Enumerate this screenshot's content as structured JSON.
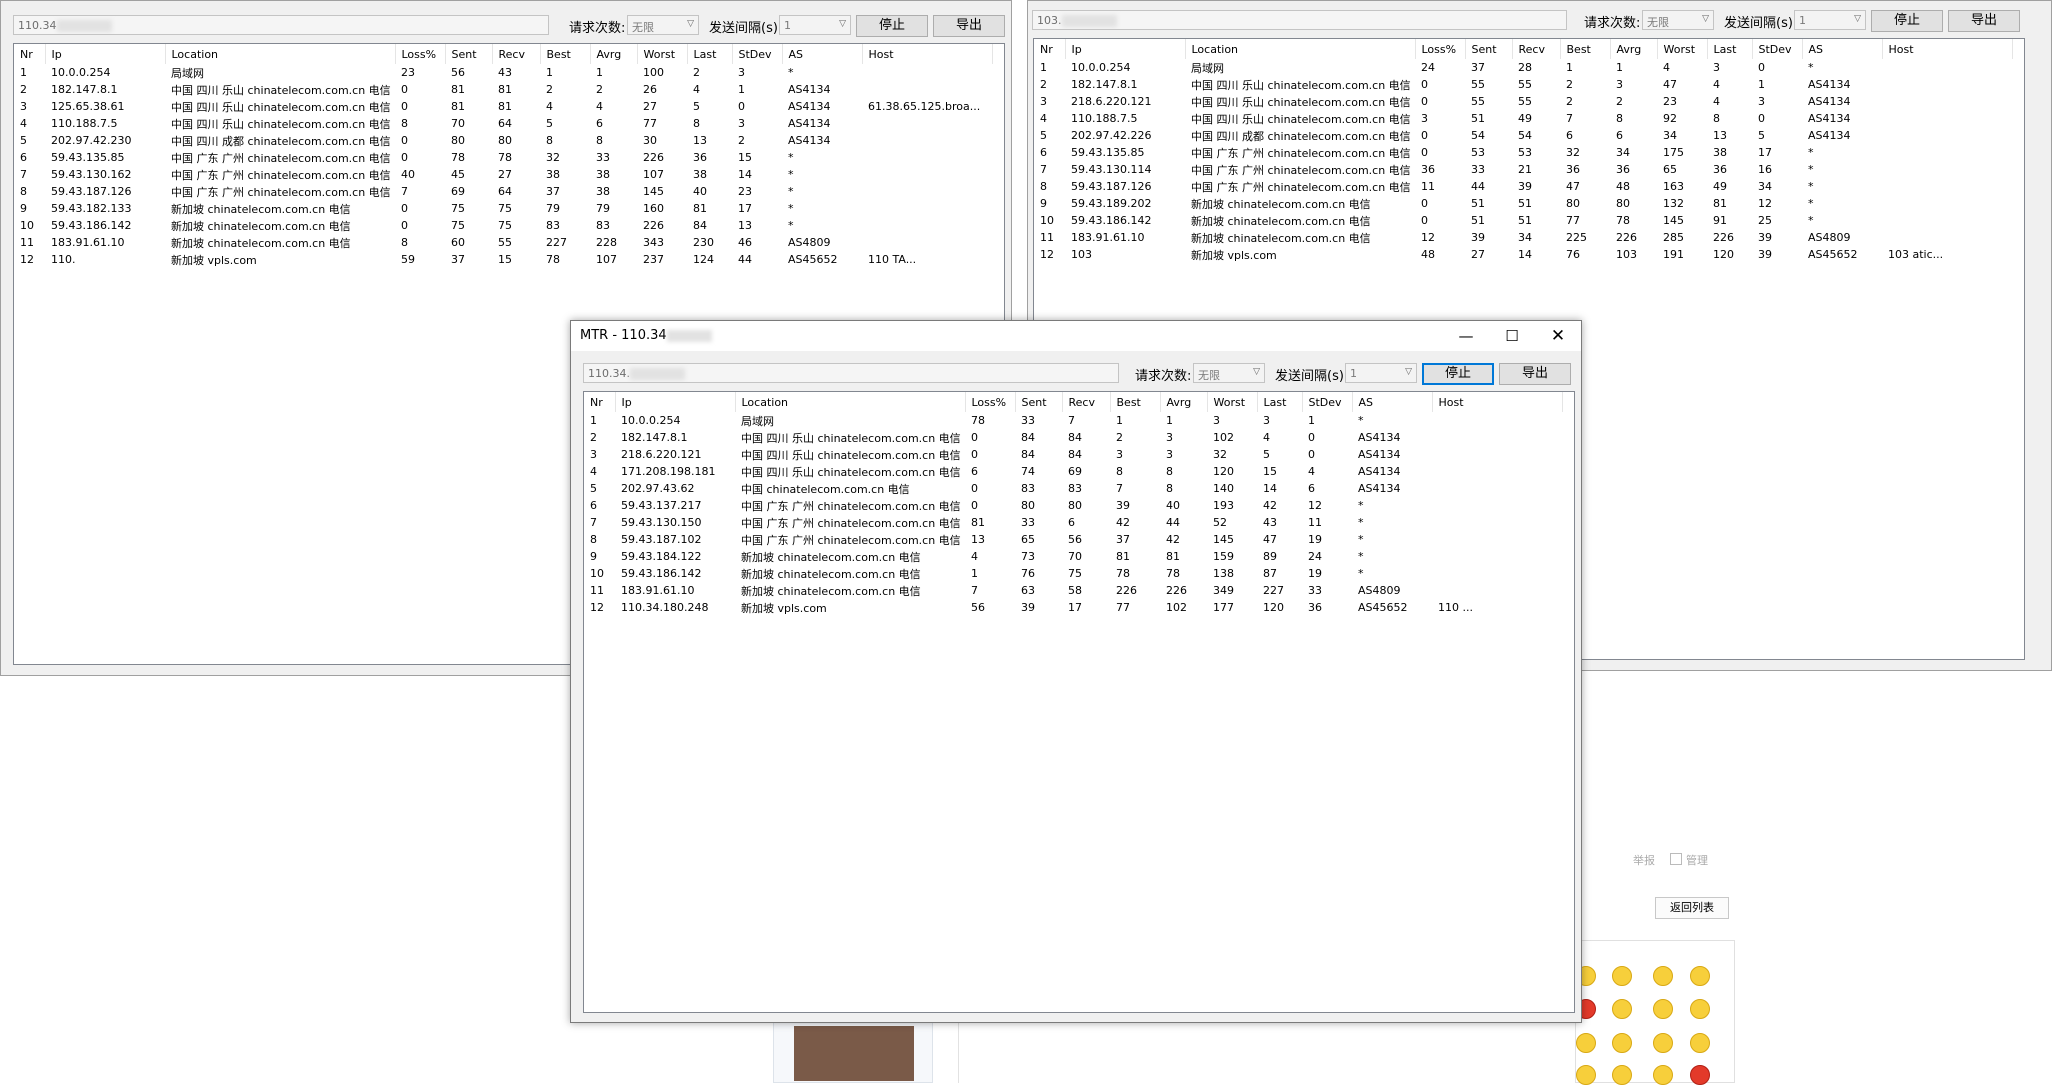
{
  "labels": {
    "req_count": "请求次数:",
    "interval": "发送间隔(s):",
    "stop": "停止",
    "export": "导出",
    "unlimited": "无限",
    "interval_val": "1"
  },
  "columns": [
    "Nr",
    "Ip",
    "Location",
    "Loss%",
    "Sent",
    "Recv",
    "Best",
    "Avrg",
    "Worst",
    "Last",
    "StDev",
    "AS",
    "Host"
  ],
  "win1": {
    "ip": "110.34",
    "rows": [
      [
        "1",
        "10.0.0.254",
        "局域网",
        "23",
        "56",
        "43",
        "1",
        "1",
        "100",
        "2",
        "3",
        "*",
        ""
      ],
      [
        "2",
        "182.147.8.1",
        "中国 四川 乐山 chinatelecom.com.cn 电信",
        "0",
        "81",
        "81",
        "2",
        "2",
        "26",
        "4",
        "1",
        "AS4134",
        ""
      ],
      [
        "3",
        "125.65.38.61",
        "中国 四川 乐山 chinatelecom.com.cn 电信",
        "0",
        "81",
        "81",
        "4",
        "4",
        "27",
        "5",
        "0",
        "AS4134",
        "61.38.65.125.broa..."
      ],
      [
        "4",
        "110.188.7.5",
        "中国 四川 乐山 chinatelecom.com.cn 电信",
        "8",
        "70",
        "64",
        "5",
        "6",
        "77",
        "8",
        "3",
        "AS4134",
        ""
      ],
      [
        "5",
        "202.97.42.230",
        "中国 四川 成都 chinatelecom.com.cn 电信",
        "0",
        "80",
        "80",
        "8",
        "8",
        "30",
        "13",
        "2",
        "AS4134",
        ""
      ],
      [
        "6",
        "59.43.135.85",
        "中国 广东 广州 chinatelecom.com.cn 电信",
        "0",
        "78",
        "78",
        "32",
        "33",
        "226",
        "36",
        "15",
        "*",
        ""
      ],
      [
        "7",
        "59.43.130.162",
        "中国 广东 广州 chinatelecom.com.cn 电信",
        "40",
        "45",
        "27",
        "38",
        "38",
        "107",
        "38",
        "14",
        "*",
        ""
      ],
      [
        "8",
        "59.43.187.126",
        "中国 广东 广州 chinatelecom.com.cn 电信",
        "7",
        "69",
        "64",
        "37",
        "38",
        "145",
        "40",
        "23",
        "*",
        ""
      ],
      [
        "9",
        "59.43.182.133",
        "新加坡 chinatelecom.com.cn 电信",
        "0",
        "75",
        "75",
        "79",
        "79",
        "160",
        "81",
        "17",
        "*",
        ""
      ],
      [
        "10",
        "59.43.186.142",
        "新加坡 chinatelecom.com.cn 电信",
        "0",
        "75",
        "75",
        "83",
        "83",
        "226",
        "84",
        "13",
        "*",
        ""
      ],
      [
        "11",
        "183.91.61.10",
        "新加坡 chinatelecom.com.cn 电信",
        "8",
        "60",
        "55",
        "227",
        "228",
        "343",
        "230",
        "46",
        "AS4809",
        ""
      ],
      [
        "12",
        "110.",
        "新加坡 vpls.com",
        "59",
        "37",
        "15",
        "78",
        "107",
        "237",
        "124",
        "44",
        "AS45652",
        "110 TA..."
      ]
    ]
  },
  "win2": {
    "ip": "103.",
    "rows": [
      [
        "1",
        "10.0.0.254",
        "局域网",
        "24",
        "37",
        "28",
        "1",
        "1",
        "4",
        "3",
        "0",
        "*",
        ""
      ],
      [
        "2",
        "182.147.8.1",
        "中国 四川 乐山 chinatelecom.com.cn 电信",
        "0",
        "55",
        "55",
        "2",
        "3",
        "47",
        "4",
        "1",
        "AS4134",
        ""
      ],
      [
        "3",
        "218.6.220.121",
        "中国 四川 乐山 chinatelecom.com.cn 电信",
        "0",
        "55",
        "55",
        "2",
        "2",
        "23",
        "4",
        "3",
        "AS4134",
        ""
      ],
      [
        "4",
        "110.188.7.5",
        "中国 四川 乐山 chinatelecom.com.cn 电信",
        "3",
        "51",
        "49",
        "7",
        "8",
        "92",
        "8",
        "0",
        "AS4134",
        ""
      ],
      [
        "5",
        "202.97.42.226",
        "中国 四川 成都 chinatelecom.com.cn 电信",
        "0",
        "54",
        "54",
        "6",
        "6",
        "34",
        "13",
        "5",
        "AS4134",
        ""
      ],
      [
        "6",
        "59.43.135.85",
        "中国 广东 广州 chinatelecom.com.cn 电信",
        "0",
        "53",
        "53",
        "32",
        "34",
        "175",
        "38",
        "17",
        "*",
        ""
      ],
      [
        "7",
        "59.43.130.114",
        "中国 广东 广州 chinatelecom.com.cn 电信",
        "36",
        "33",
        "21",
        "36",
        "36",
        "65",
        "36",
        "16",
        "*",
        ""
      ],
      [
        "8",
        "59.43.187.126",
        "中国 广东 广州 chinatelecom.com.cn 电信",
        "11",
        "44",
        "39",
        "47",
        "48",
        "163",
        "49",
        "34",
        "*",
        ""
      ],
      [
        "9",
        "59.43.189.202",
        "新加坡 chinatelecom.com.cn 电信",
        "0",
        "51",
        "51",
        "80",
        "80",
        "132",
        "81",
        "12",
        "*",
        ""
      ],
      [
        "10",
        "59.43.186.142",
        "新加坡 chinatelecom.com.cn 电信",
        "0",
        "51",
        "51",
        "77",
        "78",
        "145",
        "91",
        "25",
        "*",
        ""
      ],
      [
        "11",
        "183.91.61.10",
        "新加坡 chinatelecom.com.cn 电信",
        "12",
        "39",
        "34",
        "225",
        "226",
        "285",
        "226",
        "39",
        "AS4809",
        ""
      ],
      [
        "12",
        "103",
        "新加坡 vpls.com",
        "48",
        "27",
        "14",
        "76",
        "103",
        "191",
        "120",
        "39",
        "AS45652",
        "103 atic..."
      ]
    ]
  },
  "win3": {
    "title": "MTR - 110.34",
    "ip": "110.34.",
    "rows": [
      [
        "1",
        "10.0.0.254",
        "局域网",
        "78",
        "33",
        "7",
        "1",
        "1",
        "3",
        "3",
        "1",
        "*",
        ""
      ],
      [
        "2",
        "182.147.8.1",
        "中国 四川 乐山 chinatelecom.com.cn 电信",
        "0",
        "84",
        "84",
        "2",
        "3",
        "102",
        "4",
        "0",
        "AS4134",
        ""
      ],
      [
        "3",
        "218.6.220.121",
        "中国 四川 乐山 chinatelecom.com.cn 电信",
        "0",
        "84",
        "84",
        "3",
        "3",
        "32",
        "5",
        "0",
        "AS4134",
        ""
      ],
      [
        "4",
        "171.208.198.181",
        "中国 四川 乐山 chinatelecom.com.cn 电信",
        "6",
        "74",
        "69",
        "8",
        "8",
        "120",
        "15",
        "4",
        "AS4134",
        ""
      ],
      [
        "5",
        "202.97.43.62",
        "中国 chinatelecom.com.cn 电信",
        "0",
        "83",
        "83",
        "7",
        "8",
        "140",
        "14",
        "6",
        "AS4134",
        ""
      ],
      [
        "6",
        "59.43.137.217",
        "中国 广东 广州 chinatelecom.com.cn 电信",
        "0",
        "80",
        "80",
        "39",
        "40",
        "193",
        "42",
        "12",
        "*",
        ""
      ],
      [
        "7",
        "59.43.130.150",
        "中国 广东 广州 chinatelecom.com.cn 电信",
        "81",
        "33",
        "6",
        "42",
        "44",
        "52",
        "43",
        "11",
        "*",
        ""
      ],
      [
        "8",
        "59.43.187.102",
        "中国 广东 广州 chinatelecom.com.cn 电信",
        "13",
        "65",
        "56",
        "37",
        "42",
        "145",
        "47",
        "19",
        "*",
        ""
      ],
      [
        "9",
        "59.43.184.122",
        "新加坡 chinatelecom.com.cn 电信",
        "4",
        "73",
        "70",
        "81",
        "81",
        "159",
        "89",
        "24",
        "*",
        ""
      ],
      [
        "10",
        "59.43.186.142",
        "新加坡 chinatelecom.com.cn 电信",
        "1",
        "76",
        "75",
        "78",
        "78",
        "138",
        "87",
        "19",
        "*",
        ""
      ],
      [
        "11",
        "183.91.61.10",
        "新加坡 chinatelecom.com.cn 电信",
        "7",
        "63",
        "58",
        "226",
        "226",
        "349",
        "227",
        "33",
        "AS4809",
        ""
      ],
      [
        "12",
        "110.34.180.248",
        "新加坡 vpls.com",
        "56",
        "39",
        "17",
        "77",
        "102",
        "177",
        "120",
        "36",
        "AS45652",
        "110 ..."
      ]
    ]
  },
  "background": {
    "return_list": "返回列表",
    "report": "举报",
    "manage": "管理"
  }
}
